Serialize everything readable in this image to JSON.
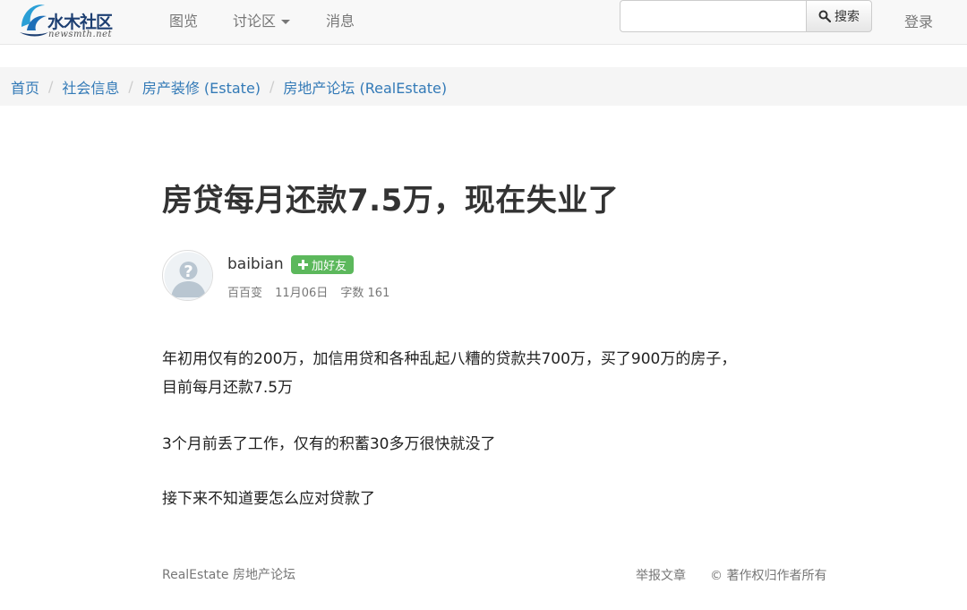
{
  "header": {
    "logo_text": "水木社区",
    "logo_sub": "newsmth.net",
    "nav": [
      "图览",
      "讨论区",
      "消息"
    ],
    "search": {
      "placeholder": "",
      "button_label": "搜索"
    },
    "login_label": "登录"
  },
  "breadcrumb": [
    "首页",
    "社会信息",
    "房产装修 (Estate)",
    "房地产论坛 (RealEstate)"
  ],
  "article": {
    "title": "房贷每月还款7.5万，现在失业了",
    "author": {
      "username": "baibian",
      "add_friend_label": "加好友",
      "nickname": "百百变",
      "date": "11月06日",
      "word_count": "字数 161"
    },
    "paragraphs": [
      "年初用仅有的200万，加信用贷和各种乱起八糟的贷款共700万，买了900万的房子，",
      "目前每月还款7.5万",
      "3个月前丢了工作，仅有的积蓄30多万很快就没了",
      "接下来不知道要怎么应对贷款了"
    ]
  },
  "footer": {
    "board": "RealEstate 房地产论坛",
    "report_label": "举报文章",
    "copyright": "© 著作权归作者所有"
  },
  "colors": {
    "link": "#337ab7",
    "add_friend": "#5cb85c",
    "logo": "#1d3f72",
    "logo_swirl": "#2a9fd6"
  }
}
